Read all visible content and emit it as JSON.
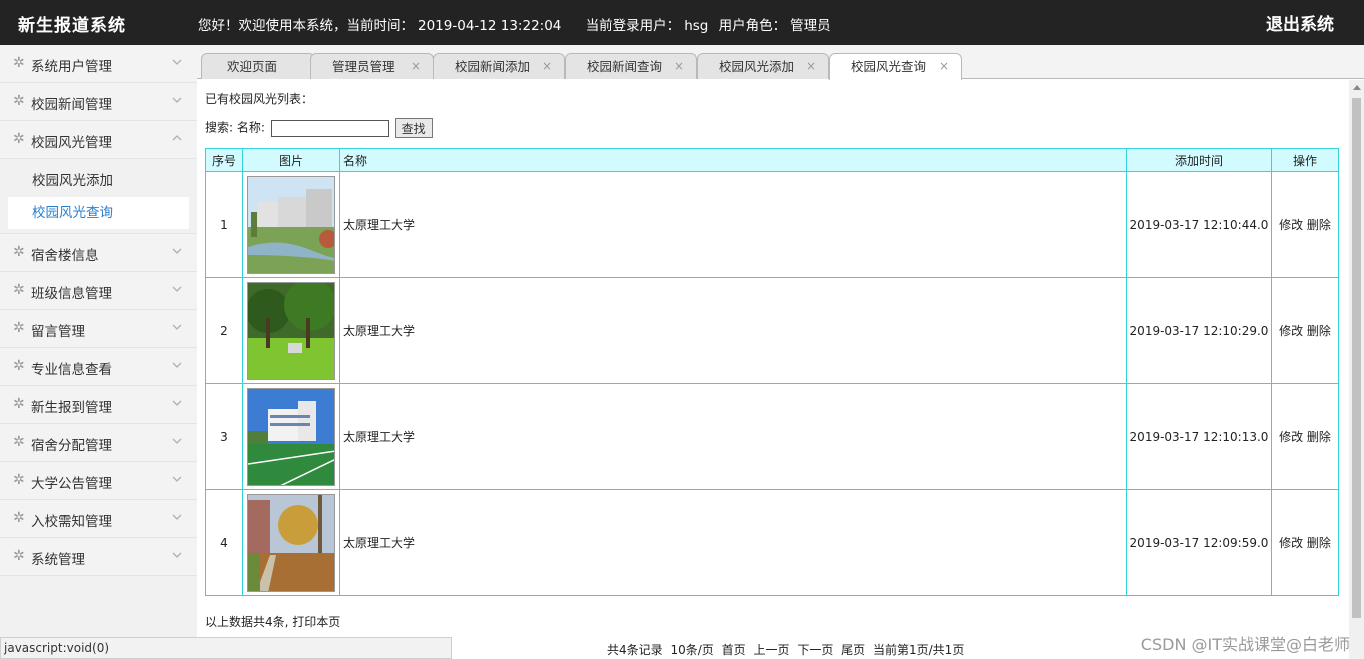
{
  "header": {
    "app_title": "新生报道系统",
    "welcome": "您好！欢迎使用本系统，当前时间：",
    "time": "2019-04-12 13:22:04",
    "login_label": "当前登录用户：",
    "user": "hsg",
    "role_label": "用户角色：",
    "role": "管理员",
    "logout": "退出系统"
  },
  "sidebar": {
    "menus": [
      {
        "label": "系统用户管理"
      },
      {
        "label": "校园新闻管理"
      },
      {
        "label": "校园风光管理",
        "expanded": true
      },
      {
        "label": "宿舍楼信息"
      },
      {
        "label": "班级信息管理"
      },
      {
        "label": "留言管理"
      },
      {
        "label": "专业信息查看"
      },
      {
        "label": "新生报到管理"
      },
      {
        "label": "宿舍分配管理"
      },
      {
        "label": "大学公告管理"
      },
      {
        "label": "入校需知管理"
      },
      {
        "label": "系统管理"
      }
    ],
    "submenu": [
      {
        "label": "校园风光添加"
      },
      {
        "label": "校园风光查询",
        "active": true
      }
    ]
  },
  "tabs": [
    {
      "label": "欢迎页面"
    },
    {
      "label": "管理员管理",
      "close": "×"
    },
    {
      "label": "校园新闻添加",
      "close": "×"
    },
    {
      "label": "校园新闻查询",
      "close": "×"
    },
    {
      "label": "校园风光添加",
      "close": "×"
    },
    {
      "label": "校园风光查询",
      "close": "×",
      "active": true
    }
  ],
  "main": {
    "list_title": "已有校园风光列表：",
    "search_label": "搜索:",
    "name_label": "名称:",
    "search_value": "",
    "search_button": "查找",
    "columns": [
      "序号",
      "图片",
      "名称",
      "添加时间",
      "操作"
    ],
    "rows": [
      {
        "idx": "1",
        "image": "campus-building-river-photo",
        "name": "太原理工大学",
        "time": "2019-03-17 12:10:44.0"
      },
      {
        "idx": "2",
        "image": "campus-lawn-trees-photo",
        "name": "太原理工大学",
        "time": "2019-03-17 12:10:29.0"
      },
      {
        "idx": "3",
        "image": "campus-sports-field-photo",
        "name": "太原理工大学",
        "time": "2019-03-17 12:10:13.0"
      },
      {
        "idx": "4",
        "image": "campus-autumn-path-photo",
        "name": "太原理工大学",
        "time": "2019-03-17 12:09:59.0"
      }
    ],
    "edit_label": "修改",
    "delete_label": "删除",
    "summary": "以上数据共4条,",
    "print_label": "打印本页"
  },
  "pager": {
    "total": "共4条记录",
    "per_page": "10条/页",
    "first": "首页",
    "prev": "上一页",
    "next": "下一页",
    "last": "尾页",
    "current": "当前第1页/共1页"
  },
  "statusbar": "javascript:void(0)",
  "watermark": "CSDN @IT实战课堂@白老师",
  "colors": {
    "header_bg": "#232323",
    "table_border": "#35d3d9",
    "table_header_bg": "#d2fbff",
    "active_link": "#2a7fd0"
  }
}
